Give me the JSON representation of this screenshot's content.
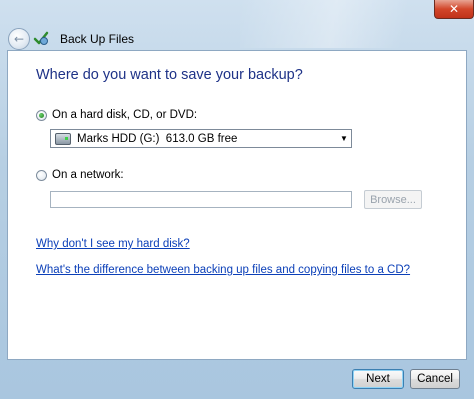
{
  "window": {
    "title": "Back Up Files",
    "close_glyph": "✕"
  },
  "nav": {
    "back_glyph": "←",
    "app_icon": "backup-app-icon"
  },
  "main": {
    "heading": "Where do you want to save your backup?",
    "options": [
      {
        "label": "On a hard disk, CD, or DVD:",
        "selected": true
      },
      {
        "label": "On a network:",
        "selected": false
      }
    ],
    "drive_select": {
      "value": "Marks HDD (G:)  613.0 GB free",
      "icon": "hard-drive-icon"
    },
    "network_path": {
      "value": ""
    },
    "browse_label": "Browse...",
    "links": [
      "Why don't I see my hard disk?",
      "What's the difference between backing up files and copying files to a CD?"
    ]
  },
  "footer": {
    "next_label": "Next",
    "cancel_label": "Cancel"
  },
  "colors": {
    "heading": "#1e3287",
    "link": "#0b3fb8",
    "frame": "#b7cfe3"
  }
}
